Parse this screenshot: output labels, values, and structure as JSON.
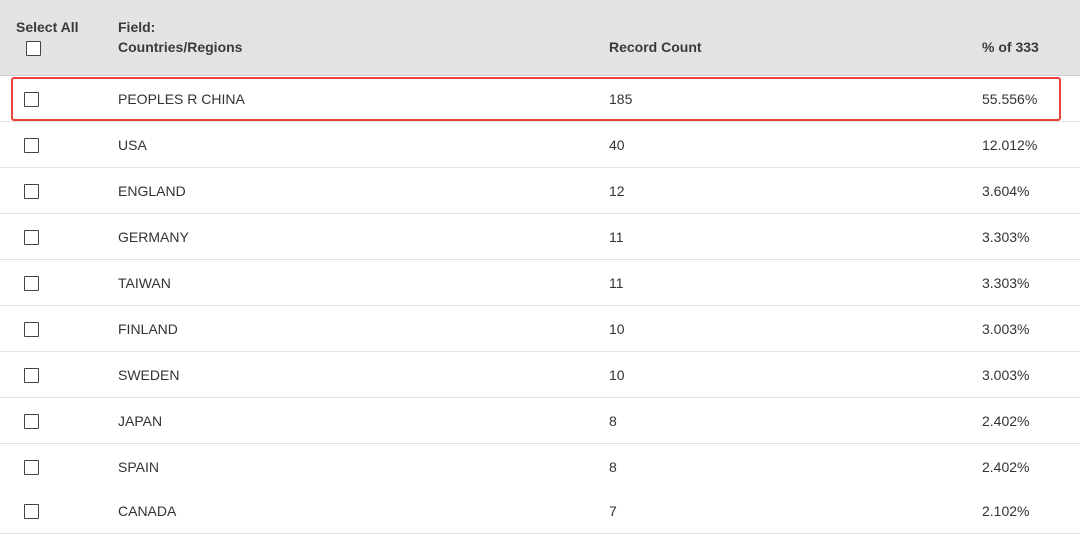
{
  "header": {
    "select_all": "Select All",
    "field_label": "Field:",
    "field_name": "Countries/Regions",
    "record_count": "Record Count",
    "percent_of": "% of 333"
  },
  "rows": [
    {
      "name": "PEOPLES R CHINA",
      "count": "185",
      "pct": "55.556%"
    },
    {
      "name": "USA",
      "count": "40",
      "pct": "12.012%"
    },
    {
      "name": "ENGLAND",
      "count": "12",
      "pct": "3.604%"
    },
    {
      "name": "GERMANY",
      "count": "11",
      "pct": "3.303%"
    },
    {
      "name": "TAIWAN",
      "count": "11",
      "pct": "3.303%"
    },
    {
      "name": "FINLAND",
      "count": "10",
      "pct": "3.003%"
    },
    {
      "name": "SWEDEN",
      "count": "10",
      "pct": "3.003%"
    },
    {
      "name": "JAPAN",
      "count": "8",
      "pct": "2.402%"
    },
    {
      "name": "SPAIN",
      "count": "8",
      "pct": "2.402%"
    },
    {
      "name": "CANADA",
      "count": "7",
      "pct": "2.102%"
    }
  ],
  "colors": {
    "header_bg": "#e3e3e6",
    "highlight_border": "#e8403a",
    "row_divider": "#e2e2e2"
  }
}
